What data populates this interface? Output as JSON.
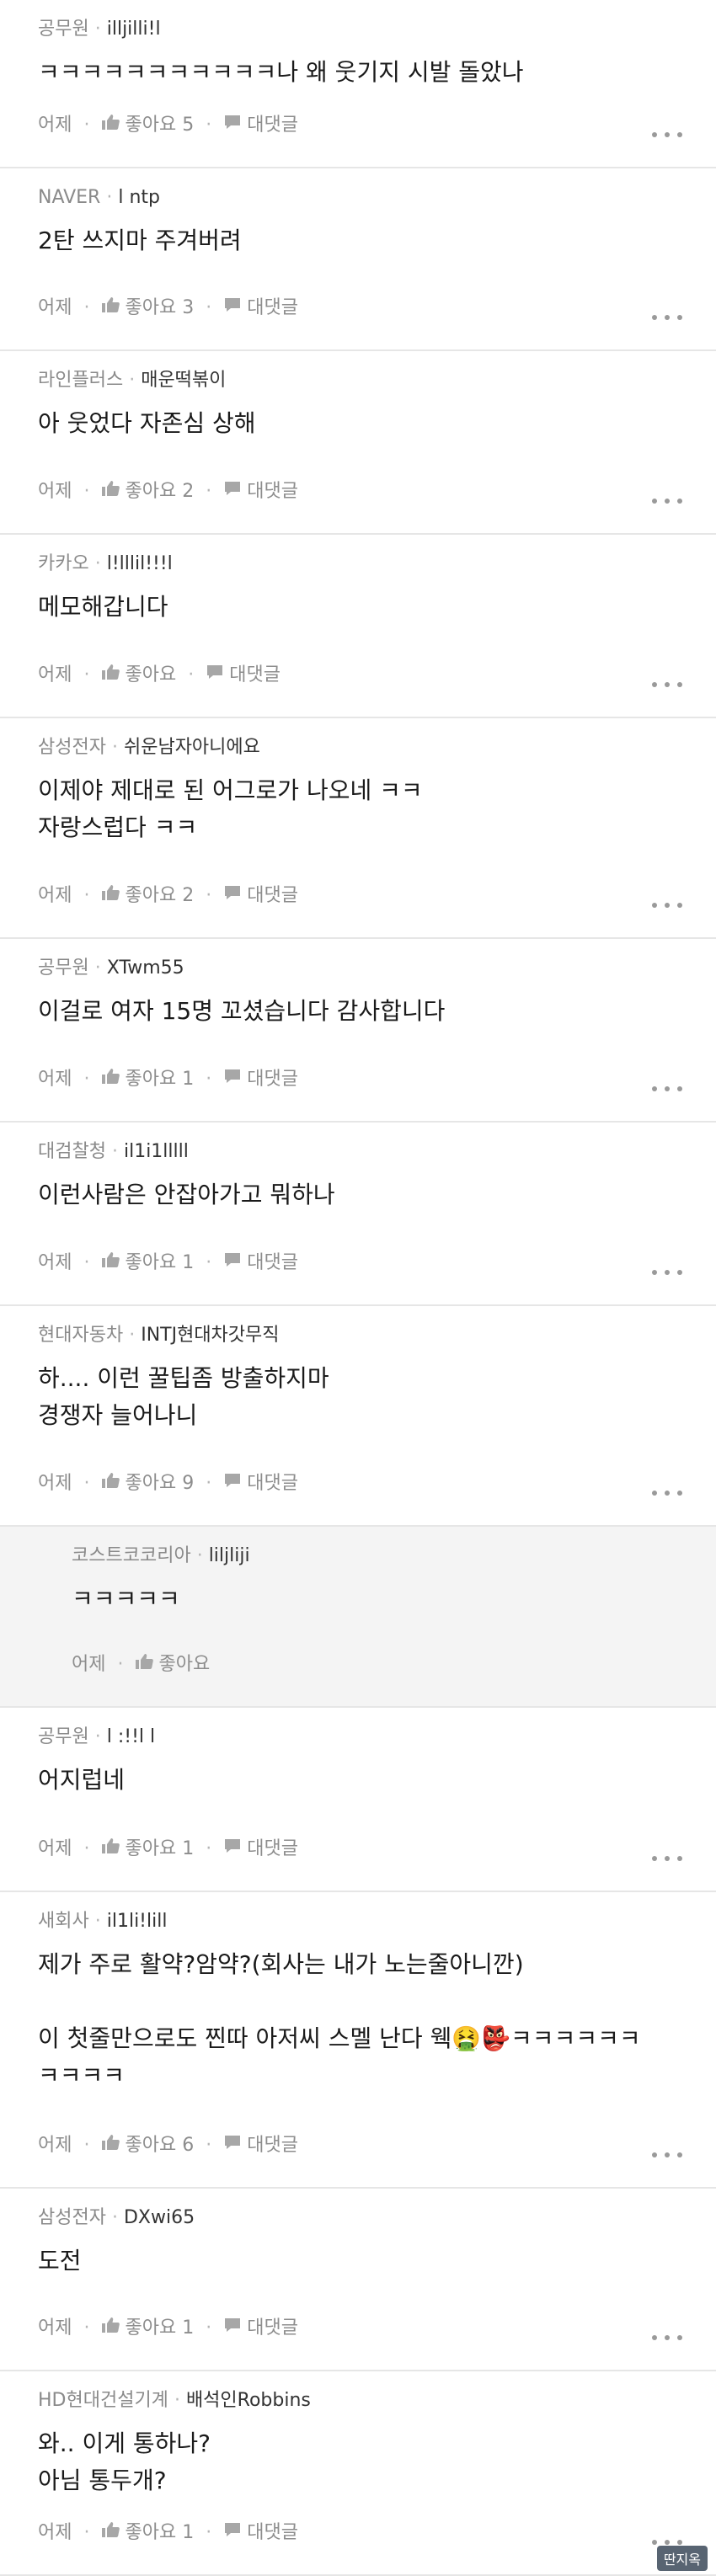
{
  "labels": {
    "time": "어제",
    "like": "좋아요",
    "reply": "대댓글"
  },
  "comments": [
    {
      "company": "공무원",
      "nick": "illjilli!l",
      "text": "ㅋㅋㅋㅋㅋㅋㅋㅋㅋㅋㅋ나 왜 웃기지 시발 돌았나",
      "likes": "5",
      "reply": true
    },
    {
      "company": "NAVER",
      "nick": "l ntp",
      "text": "2탄 쓰지마 주겨버려",
      "likes": "3",
      "reply": true
    },
    {
      "company": "라인플러스",
      "nick": "매운떡볶이",
      "text": "아 웃었다 자존심 상해",
      "likes": "2",
      "reply": true
    },
    {
      "company": "카카오",
      "nick": "l!lllil!!!l",
      "text": "메모해갑니다",
      "likes": "",
      "reply": true
    },
    {
      "company": "삼성전자",
      "nick": "쉬운남자아니에요",
      "text": "이제야 제대로 된 어그로가 나오네 ㅋㅋ\n자랑스럽다 ㅋㅋ",
      "likes": "2",
      "reply": true
    },
    {
      "company": "공무원",
      "nick": "XTwm55",
      "text": "이걸로 여자 15명 꼬셨습니다 감사합니다",
      "likes": "1",
      "reply": true
    },
    {
      "company": "대검찰청",
      "nick": "il1i1lllll",
      "text": "이런사람은 안잡아가고 뭐하나",
      "likes": "1",
      "reply": true
    },
    {
      "company": "현대자동차",
      "nick": "INTJ현대차갓무직",
      "text": "하.... 이런 꿀팁좀 방출하지마\n경쟁자 늘어나니",
      "likes": "9",
      "reply": true
    },
    {
      "company": "코스트코코리아",
      "nick": "liljliji",
      "text": "ㅋㅋㅋㅋㅋ",
      "likes": "",
      "reply": false,
      "is_reply": true
    },
    {
      "company": "공무원",
      "nick": "l :!!l l",
      "text": "어지럽네",
      "likes": "1",
      "reply": true
    },
    {
      "company": "새회사",
      "nick": "il1li!lill",
      "text": "제가 주로 활약?암약?(회사는 내가 노는줄아니깐)\n\n이 첫줄만으로도 찐따 아저씨 스멜 난다 웩🤮👺ㅋㅋㅋㅋㅋㅋ\nㅋㅋㅋㅋ",
      "likes": "6",
      "reply": true
    },
    {
      "company": "삼성전자",
      "nick": "DXwi65",
      "text": "도전",
      "likes": "1",
      "reply": true
    },
    {
      "company": "HD현대건설기계",
      "nick": "배석인Robbins",
      "text": "와.. 이게 통하나?\n아님 통두개?",
      "likes": "1",
      "reply": true
    }
  ],
  "watermark": "딴지옥"
}
